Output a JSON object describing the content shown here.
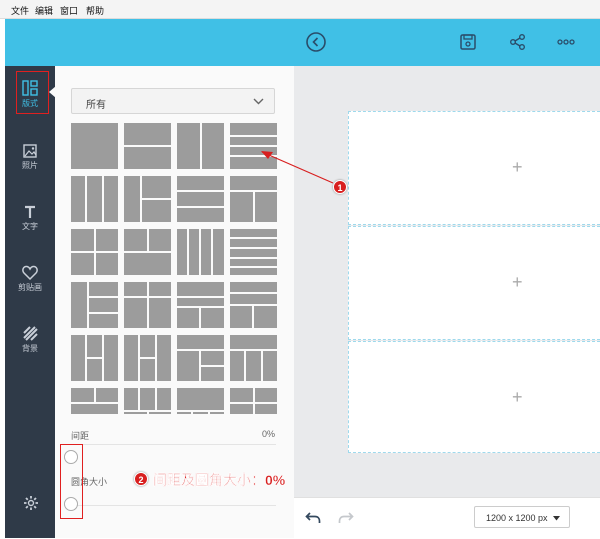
{
  "menu": {
    "file": "文件",
    "edit": "编辑",
    "window": "窗口",
    "help": "帮助"
  },
  "nav": {
    "layout": "版式",
    "photos": "照片",
    "text": "文字",
    "clipart": "剪贴画",
    "background": "背景"
  },
  "filter": {
    "value": "所有"
  },
  "spacing": {
    "label": "间距",
    "value": "0%"
  },
  "radius": {
    "label": "圆角大小"
  },
  "canvas": {
    "slot_glyph": "+",
    "size": "1200 x 1200 px"
  },
  "annotations": {
    "one": "1",
    "two": "2",
    "text": "间距及圆角大小：0%"
  },
  "colors": {
    "accent": "#40c0e6",
    "sidebar": "#2f3a48",
    "annotation": "#d81f1f",
    "tile": "#9c9c9c"
  }
}
